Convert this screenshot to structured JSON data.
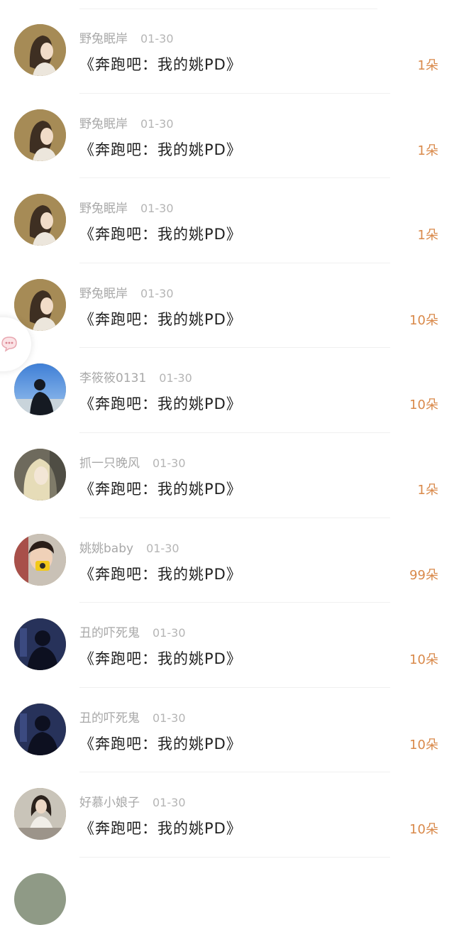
{
  "list": {
    "items": [
      {
        "user": "野兔眠岸",
        "date": "01-30",
        "title": "《奔跑吧：我的姚PD》",
        "amount": "1朵",
        "avatar": "avatar-girl-illustration"
      },
      {
        "user": "野兔眠岸",
        "date": "01-30",
        "title": "《奔跑吧：我的姚PD》",
        "amount": "1朵",
        "avatar": "avatar-girl-illustration"
      },
      {
        "user": "野兔眠岸",
        "date": "01-30",
        "title": "《奔跑吧：我的姚PD》",
        "amount": "1朵",
        "avatar": "avatar-girl-illustration"
      },
      {
        "user": "野兔眠岸",
        "date": "01-30",
        "title": "《奔跑吧：我的姚PD》",
        "amount": "10朵",
        "avatar": "avatar-girl-illustration"
      },
      {
        "user": "李筱筱0131",
        "date": "01-30",
        "title": "《奔跑吧：我的姚PD》",
        "amount": "10朵",
        "avatar": "avatar-silhouette-sky"
      },
      {
        "user": "抓一只晚风",
        "date": "01-30",
        "title": "《奔跑吧：我的姚PD》",
        "amount": "1朵",
        "avatar": "avatar-blonde-girl"
      },
      {
        "user": "姚姚baby",
        "date": "01-30",
        "title": "《奔跑吧：我的姚PD》",
        "amount": "99朵",
        "avatar": "avatar-child-camera"
      },
      {
        "user": "丑的吓死鬼",
        "date": "01-30",
        "title": "《奔跑吧：我的姚PD》",
        "amount": "10朵",
        "avatar": "avatar-shadow-blue"
      },
      {
        "user": "丑的吓死鬼",
        "date": "01-30",
        "title": "《奔跑吧：我的姚PD》",
        "amount": "10朵",
        "avatar": "avatar-shadow-blue"
      },
      {
        "user": "好慕小娘子",
        "date": "01-30",
        "title": "《奔跑吧：我的姚PD》",
        "amount": "10朵",
        "avatar": "avatar-woman-sitting"
      }
    ]
  },
  "floating": {
    "icon": "chat-bubble-icon"
  },
  "colors": {
    "amount": "#d9894a",
    "meta": "#a8a8a8",
    "title": "#222222",
    "divider": "#f0f0f0"
  }
}
